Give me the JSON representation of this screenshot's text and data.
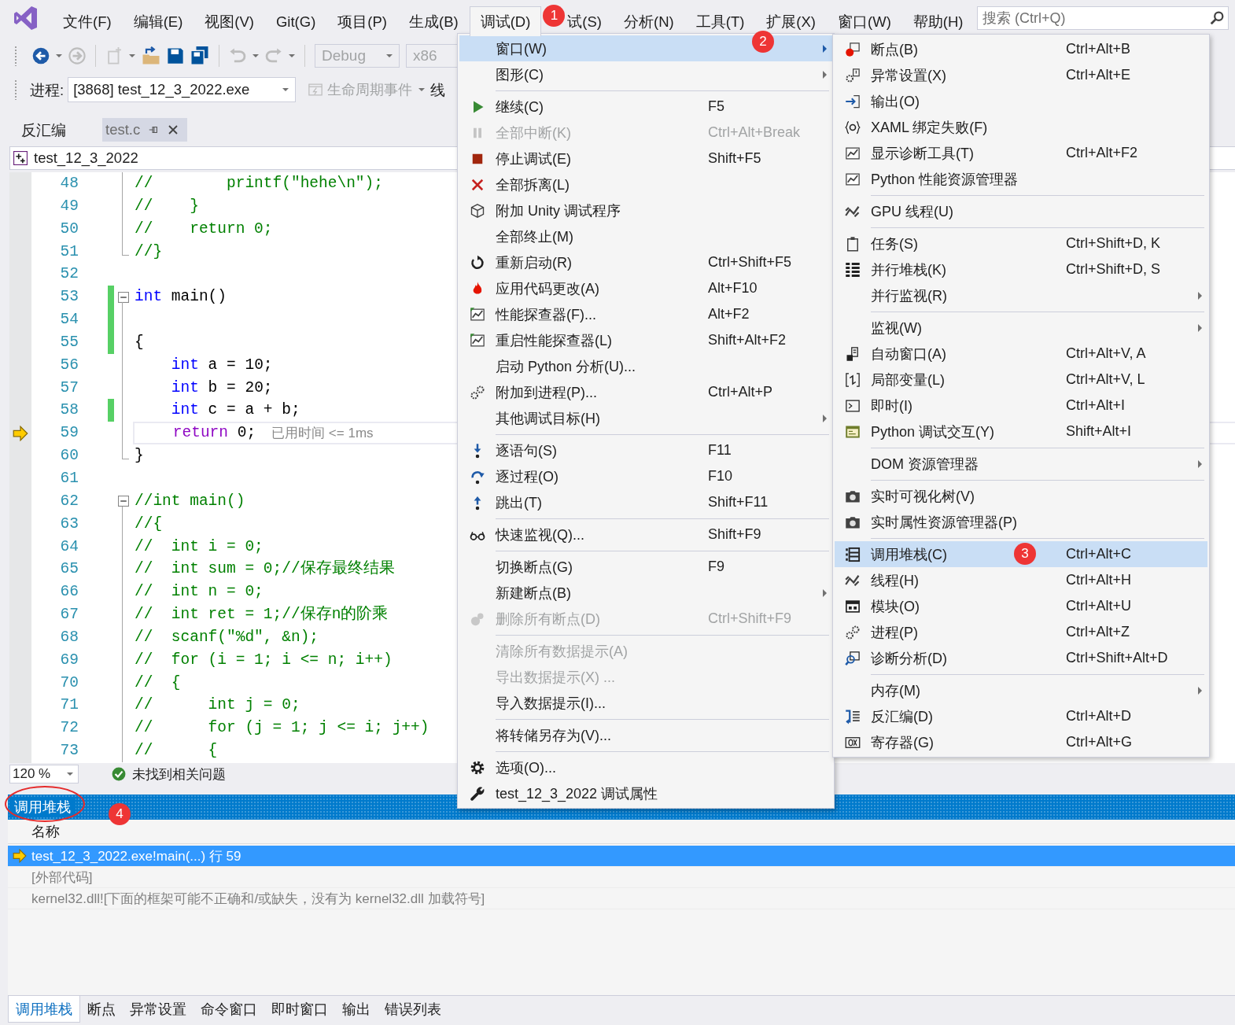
{
  "menubar": {
    "items": [
      {
        "label": "文件(F)",
        "selected": false
      },
      {
        "label": "编辑(E)",
        "selected": false
      },
      {
        "label": "视图(V)",
        "selected": false
      },
      {
        "label": "Git(G)",
        "selected": false
      },
      {
        "label": "项目(P)",
        "selected": false
      },
      {
        "label": "生成(B)",
        "selected": false
      },
      {
        "label": "调试(D)",
        "selected": true
      },
      {
        "label": "试(S)",
        "selected": false,
        "badge": "1"
      },
      {
        "label": "分析(N)",
        "selected": false
      },
      {
        "label": "工具(T)",
        "selected": false
      },
      {
        "label": "扩展(X)",
        "selected": false
      },
      {
        "label": "窗口(W)",
        "selected": false
      },
      {
        "label": "帮助(H)",
        "selected": false
      }
    ]
  },
  "search": {
    "placeholder": "搜索 (Ctrl+Q)"
  },
  "toolbar": {
    "configuration": "Debug",
    "platform": "x86"
  },
  "process_bar": {
    "label": "进程:",
    "process": "[3868] test_12_3_2022.exe",
    "lifecycle": "生命周期事件",
    "thread_label": "线"
  },
  "document_tabs": [
    {
      "label": "反汇编",
      "selected": false
    },
    {
      "label": "test.c",
      "selected": true
    }
  ],
  "navigation": {
    "scope": "test_12_3_2022"
  },
  "editor": {
    "lines": [
      {
        "number": "48",
        "kind": "body",
        "changed": false,
        "current": false,
        "tokens": [
          {
            "kind": "comment",
            "text": "//        printf(\"hehe\\n\");"
          }
        ]
      },
      {
        "number": "49",
        "kind": "body",
        "changed": false,
        "current": false,
        "tokens": [
          {
            "kind": "comment",
            "text": "//    }"
          }
        ]
      },
      {
        "number": "50",
        "kind": "body",
        "changed": false,
        "current": false,
        "tokens": [
          {
            "kind": "comment",
            "text": "//    return 0;"
          }
        ]
      },
      {
        "number": "51",
        "kind": "end",
        "changed": false,
        "current": false,
        "tokens": [
          {
            "kind": "comment",
            "text": "//}"
          }
        ]
      },
      {
        "number": "52",
        "kind": "plain",
        "changed": false,
        "current": false
      },
      {
        "number": "53",
        "kind": "start",
        "changed": true,
        "current": false,
        "tokens": [
          {
            "kind": "keyword",
            "text": "int"
          },
          {
            "kind": "text",
            "text": " main()"
          }
        ]
      },
      {
        "number": "54",
        "kind": "body",
        "changed": true,
        "current": false
      },
      {
        "number": "55",
        "kind": "body",
        "changed": true,
        "current": false,
        "tokens": [
          {
            "kind": "text",
            "text": "{"
          }
        ]
      },
      {
        "number": "56",
        "kind": "body",
        "changed": false,
        "current": false,
        "tokens": [
          {
            "kind": "keyword",
            "text": "    int"
          },
          {
            "kind": "text",
            "text": " a = 10;"
          }
        ]
      },
      {
        "number": "57",
        "kind": "body",
        "changed": false,
        "current": false,
        "tokens": [
          {
            "kind": "keyword",
            "text": "    int"
          },
          {
            "kind": "text",
            "text": " b = 20;"
          }
        ]
      },
      {
        "number": "58",
        "kind": "body",
        "changed": true,
        "current": false,
        "tokens": [
          {
            "kind": "keyword",
            "text": "    int"
          },
          {
            "kind": "text",
            "text": " c = a + b;"
          }
        ]
      },
      {
        "number": "59",
        "kind": "body",
        "changed": false,
        "current": true,
        "hint": "已用时间 <= 1ms",
        "tokens": [
          {
            "kind": "control",
            "text": "    return"
          },
          {
            "kind": "text",
            "text": " 0;"
          }
        ]
      },
      {
        "number": "60",
        "kind": "end",
        "changed": false,
        "current": false,
        "tokens": [
          {
            "kind": "text",
            "text": "}"
          }
        ]
      },
      {
        "number": "61",
        "kind": "plain",
        "changed": false,
        "current": false
      },
      {
        "number": "62",
        "kind": "start",
        "changed": false,
        "current": false,
        "tokens": [
          {
            "kind": "comment",
            "text": "//int main()"
          }
        ]
      },
      {
        "number": "63",
        "kind": "body",
        "changed": false,
        "current": false,
        "tokens": [
          {
            "kind": "comment",
            "text": "//{"
          }
        ]
      },
      {
        "number": "64",
        "kind": "body",
        "changed": false,
        "current": false,
        "tokens": [
          {
            "kind": "comment",
            "text": "//  int i = 0;"
          }
        ]
      },
      {
        "number": "65",
        "kind": "body",
        "changed": false,
        "current": false,
        "tokens": [
          {
            "kind": "comment",
            "text": "//  int sum = 0;//保存最终结果"
          }
        ]
      },
      {
        "number": "66",
        "kind": "body",
        "changed": false,
        "current": false,
        "tokens": [
          {
            "kind": "comment",
            "text": "//  int n = 0;"
          }
        ]
      },
      {
        "number": "67",
        "kind": "body",
        "changed": false,
        "current": false,
        "tokens": [
          {
            "kind": "comment",
            "text": "//  int ret = 1;//保存n的阶乘"
          }
        ]
      },
      {
        "number": "68",
        "kind": "body",
        "changed": false,
        "current": false,
        "tokens": [
          {
            "kind": "comment",
            "text": "//  scanf(\"%d\", &n);"
          }
        ]
      },
      {
        "number": "69",
        "kind": "body",
        "changed": false,
        "current": false,
        "tokens": [
          {
            "kind": "comment",
            "text": "//  for (i = 1; i <= n; i++)"
          }
        ]
      },
      {
        "number": "70",
        "kind": "body",
        "changed": false,
        "current": false,
        "tokens": [
          {
            "kind": "comment",
            "text": "//  {"
          }
        ]
      },
      {
        "number": "71",
        "kind": "body",
        "changed": false,
        "current": false,
        "tokens": [
          {
            "kind": "comment",
            "text": "//      int j = 0;"
          }
        ]
      },
      {
        "number": "72",
        "kind": "body",
        "changed": false,
        "current": false,
        "tokens": [
          {
            "kind": "comment",
            "text": "//      for (j = 1; j <= i; j++)"
          }
        ]
      },
      {
        "number": "73",
        "kind": "body",
        "changed": false,
        "current": false,
        "tokens": [
          {
            "kind": "comment",
            "text": "//      {"
          }
        ]
      }
    ]
  },
  "status": {
    "zoom": "120 %",
    "issues": "未找到相关问题"
  },
  "debug_menu": {
    "items": [
      {
        "kind": "item",
        "label": "窗口(W)",
        "selected": true,
        "disabled": false,
        "submenu": true,
        "badge": "2"
      },
      {
        "kind": "item",
        "label": "图形(C)",
        "selected": false,
        "disabled": false,
        "submenu": true
      },
      {
        "kind": "separator"
      },
      {
        "kind": "item",
        "label": "继续(C)",
        "shortcut": "F5",
        "selected": false,
        "disabled": false,
        "submenu": false
      },
      {
        "kind": "item",
        "label": "全部中断(K)",
        "shortcut": "Ctrl+Alt+Break",
        "selected": false,
        "disabled": true,
        "submenu": false
      },
      {
        "kind": "item",
        "label": "停止调试(E)",
        "shortcut": "Shift+F5",
        "selected": false,
        "disabled": false,
        "submenu": false
      },
      {
        "kind": "item",
        "label": "全部拆离(L)",
        "selected": false,
        "disabled": false,
        "submenu": false
      },
      {
        "kind": "item",
        "label": "附加 Unity 调试程序",
        "selected": false,
        "disabled": false,
        "submenu": false
      },
      {
        "kind": "item",
        "label": "全部终止(M)",
        "selected": false,
        "disabled": false,
        "submenu": false
      },
      {
        "kind": "item",
        "label": "重新启动(R)",
        "shortcut": "Ctrl+Shift+F5",
        "selected": false,
        "disabled": false,
        "submenu": false
      },
      {
        "kind": "item",
        "label": "应用代码更改(A)",
        "shortcut": "Alt+F10",
        "selected": false,
        "disabled": false,
        "submenu": false
      },
      {
        "kind": "item",
        "label": "性能探查器(F)...",
        "shortcut": "Alt+F2",
        "selected": false,
        "disabled": false,
        "submenu": false
      },
      {
        "kind": "item",
        "label": "重启性能探查器(L)",
        "shortcut": "Shift+Alt+F2",
        "selected": false,
        "disabled": false,
        "submenu": false
      },
      {
        "kind": "item",
        "label": "启动 Python 分析(U)...",
        "selected": false,
        "disabled": false,
        "submenu": false
      },
      {
        "kind": "item",
        "label": "附加到进程(P)...",
        "shortcut": "Ctrl+Alt+P",
        "selected": false,
        "disabled": false,
        "submenu": false
      },
      {
        "kind": "item",
        "label": "其他调试目标(H)",
        "selected": false,
        "disabled": false,
        "submenu": true
      },
      {
        "kind": "separator"
      },
      {
        "kind": "item",
        "label": "逐语句(S)",
        "shortcut": "F11",
        "selected": false,
        "disabled": false,
        "submenu": false
      },
      {
        "kind": "item",
        "label": "逐过程(O)",
        "shortcut": "F10",
        "selected": false,
        "disabled": false,
        "submenu": false
      },
      {
        "kind": "item",
        "label": "跳出(T)",
        "shortcut": "Shift+F11",
        "selected": false,
        "disabled": false,
        "submenu": false
      },
      {
        "kind": "separator"
      },
      {
        "kind": "item",
        "label": "快速监视(Q)...",
        "shortcut": "Shift+F9",
        "selected": false,
        "disabled": false,
        "submenu": false
      },
      {
        "kind": "separator"
      },
      {
        "kind": "item",
        "label": "切换断点(G)",
        "shortcut": "F9",
        "selected": false,
        "disabled": false,
        "submenu": false
      },
      {
        "kind": "item",
        "label": "新建断点(B)",
        "selected": false,
        "disabled": false,
        "submenu": true
      },
      {
        "kind": "item",
        "label": "删除所有断点(D)",
        "shortcut": "Ctrl+Shift+F9",
        "selected": false,
        "disabled": true,
        "submenu": false
      },
      {
        "kind": "separator"
      },
      {
        "kind": "item",
        "label": "清除所有数据提示(A)",
        "selected": false,
        "disabled": true,
        "submenu": false
      },
      {
        "kind": "item",
        "label": "导出数据提示(X) ...",
        "selected": false,
        "disabled": true,
        "submenu": false
      },
      {
        "kind": "item",
        "label": "导入数据提示(I)...",
        "selected": false,
        "disabled": false,
        "submenu": false
      },
      {
        "kind": "separator"
      },
      {
        "kind": "item",
        "label": "将转储另存为(V)...",
        "selected": false,
        "disabled": false,
        "submenu": false
      },
      {
        "kind": "separator"
      },
      {
        "kind": "item",
        "label": "选项(O)...",
        "selected": false,
        "disabled": false,
        "submenu": false
      },
      {
        "kind": "item",
        "label": "test_12_3_2022 调试属性",
        "selected": false,
        "disabled": false,
        "submenu": false
      }
    ]
  },
  "window_menu": {
    "items": [
      {
        "kind": "item",
        "label": "断点(B)",
        "shortcut": "Ctrl+Alt+B",
        "selected": false,
        "submenu": false
      },
      {
        "kind": "item",
        "label": "异常设置(X)",
        "shortcut": "Ctrl+Alt+E",
        "selected": false,
        "submenu": false
      },
      {
        "kind": "item",
        "label": "输出(O)",
        "selected": false,
        "submenu": false
      },
      {
        "kind": "item",
        "label": "XAML 绑定失败(F)",
        "selected": false,
        "submenu": false
      },
      {
        "kind": "item",
        "label": "显示诊断工具(T)",
        "shortcut": "Ctrl+Alt+F2",
        "selected": false,
        "submenu": false
      },
      {
        "kind": "item",
        "label": "Python 性能资源管理器",
        "selected": false,
        "submenu": false
      },
      {
        "kind": "separator"
      },
      {
        "kind": "item",
        "label": "GPU 线程(U)",
        "selected": false,
        "submenu": false
      },
      {
        "kind": "separator"
      },
      {
        "kind": "item",
        "label": "任务(S)",
        "shortcut": "Ctrl+Shift+D, K",
        "selected": false,
        "submenu": false
      },
      {
        "kind": "item",
        "label": "并行堆栈(K)",
        "shortcut": "Ctrl+Shift+D, S",
        "selected": false,
        "submenu": false
      },
      {
        "kind": "item",
        "label": "并行监视(R)",
        "selected": false,
        "submenu": true
      },
      {
        "kind": "separator"
      },
      {
        "kind": "item",
        "label": "监视(W)",
        "selected": false,
        "submenu": true
      },
      {
        "kind": "item",
        "label": "自动窗口(A)",
        "shortcut": "Ctrl+Alt+V, A",
        "selected": false,
        "submenu": false
      },
      {
        "kind": "item",
        "label": "局部变量(L)",
        "shortcut": "Ctrl+Alt+V, L",
        "selected": false,
        "submenu": false
      },
      {
        "kind": "item",
        "label": "即时(I)",
        "shortcut": "Ctrl+Alt+I",
        "selected": false,
        "submenu": false
      },
      {
        "kind": "item",
        "label": "Python 调试交互(Y)",
        "shortcut": "Shift+Alt+I",
        "selected": false,
        "submenu": false
      },
      {
        "kind": "separator"
      },
      {
        "kind": "item",
        "label": "DOM 资源管理器",
        "selected": false,
        "submenu": true
      },
      {
        "kind": "separator"
      },
      {
        "kind": "item",
        "label": "实时可视化树(V)",
        "selected": false,
        "submenu": false
      },
      {
        "kind": "item",
        "label": "实时属性资源管理器(P)",
        "selected": false,
        "submenu": false
      },
      {
        "kind": "separator"
      },
      {
        "kind": "item",
        "label": "调用堆栈(C)",
        "shortcut": "Ctrl+Alt+C",
        "selected": true,
        "submenu": false,
        "badge": "3"
      },
      {
        "kind": "item",
        "label": "线程(H)",
        "shortcut": "Ctrl+Alt+H",
        "selected": false,
        "submenu": false
      },
      {
        "kind": "item",
        "label": "模块(O)",
        "shortcut": "Ctrl+Alt+U",
        "selected": false,
        "submenu": false
      },
      {
        "kind": "item",
        "label": "进程(P)",
        "shortcut": "Ctrl+Alt+Z",
        "selected": false,
        "submenu": false
      },
      {
        "kind": "item",
        "label": "诊断分析(D)",
        "shortcut": "Ctrl+Shift+Alt+D",
        "selected": false,
        "submenu": false
      },
      {
        "kind": "separator"
      },
      {
        "kind": "item",
        "label": "内存(M)",
        "selected": false,
        "submenu": true
      },
      {
        "kind": "item",
        "label": "反汇编(D)",
        "shortcut": "Ctrl+Alt+D",
        "selected": false,
        "submenu": false
      },
      {
        "kind": "item",
        "label": "寄存器(G)",
        "shortcut": "Ctrl+Alt+G",
        "selected": false,
        "submenu": false
      }
    ]
  },
  "call_stack": {
    "title": "调用堆栈",
    "badge": "4",
    "circled": true,
    "column": "名称",
    "rows": [
      {
        "text": "test_12_3_2022.exe!main(...) 行 59",
        "selected": true,
        "current": true,
        "dimmed": false
      },
      {
        "text": "[外部代码]",
        "selected": false,
        "current": false,
        "dimmed": true
      },
      {
        "text": "kernel32.dll![下面的框架可能不正确和/或缺失，没有为 kernel32.dll 加载符号]",
        "selected": false,
        "current": false,
        "dimmed": true
      }
    ]
  },
  "bottom_tabs": [
    {
      "label": "调用堆栈",
      "selected": true
    },
    {
      "label": "断点",
      "selected": false
    },
    {
      "label": "异常设置",
      "selected": false
    },
    {
      "label": "命令窗口",
      "selected": false
    },
    {
      "label": "即时窗口",
      "selected": false
    },
    {
      "label": "输出",
      "selected": false
    },
    {
      "label": "错误列表",
      "selected": false
    }
  ]
}
